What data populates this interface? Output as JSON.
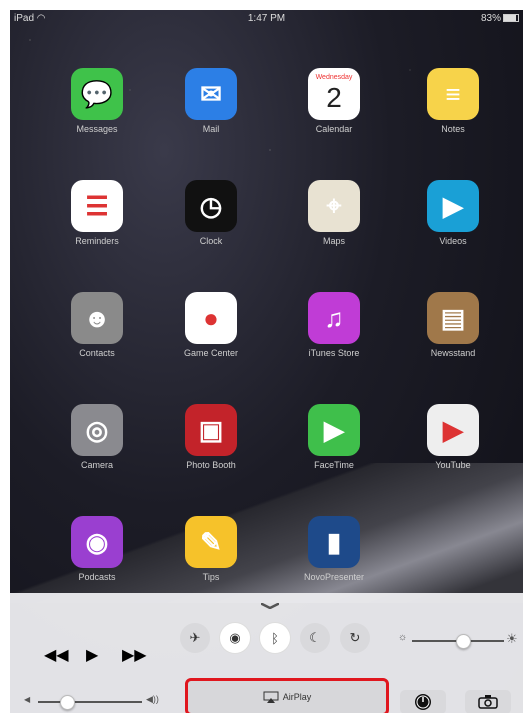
{
  "status": {
    "left": "iPad",
    "time": "1:47 PM",
    "battery": "83%"
  },
  "apps": [
    {
      "label": "Messages",
      "icon": "messages-icon",
      "color": "#3fc24a"
    },
    {
      "label": "Mail",
      "icon": "mail-icon",
      "color": "#2c7fe6"
    },
    {
      "label": "Calendar",
      "icon": "calendar-icon",
      "color": "#ffffff",
      "day_name": "Wednesday",
      "day_num": "2"
    },
    {
      "label": "Notes",
      "icon": "notes-icon",
      "color": "#f7d34a"
    },
    {
      "label": "Reminders",
      "icon": "reminders-icon",
      "color": "#ffffff"
    },
    {
      "label": "Clock",
      "icon": "clock-icon",
      "color": "#111111"
    },
    {
      "label": "Maps",
      "icon": "maps-icon",
      "color": "#e8e2d2"
    },
    {
      "label": "Videos",
      "icon": "videos-icon",
      "color": "#1aa0d6"
    },
    {
      "label": "Contacts",
      "icon": "contacts-icon",
      "color": "#8a8a8a"
    },
    {
      "label": "Game Center",
      "icon": "game-center-icon",
      "color": "#ffffff"
    },
    {
      "label": "iTunes Store",
      "icon": "itunes-store-icon",
      "color": "#c03cd6"
    },
    {
      "label": "Newsstand",
      "icon": "newsstand-icon",
      "color": "#a0784a"
    },
    {
      "label": "Camera",
      "icon": "camera-icon",
      "color": "#8a8a8f"
    },
    {
      "label": "Photo Booth",
      "icon": "photo-booth-icon",
      "color": "#c3232a"
    },
    {
      "label": "FaceTime",
      "icon": "facetime-icon",
      "color": "#3fbf4b"
    },
    {
      "label": "YouTube",
      "icon": "youtube-icon",
      "color": "#eeeeee"
    },
    {
      "label": "Podcasts",
      "icon": "podcasts-icon",
      "color": "#9a3fd0"
    },
    {
      "label": "Tips",
      "icon": "tips-icon",
      "color": "#f6c22a"
    },
    {
      "label": "NovoPresenter",
      "icon": "novopresenter-icon",
      "color": "#1e4a8a"
    }
  ],
  "control_center": {
    "airplay_label": "AirPlay",
    "toggles": [
      "airplane-mode-icon",
      "wifi-icon",
      "bluetooth-icon",
      "do-not-disturb-icon",
      "rotation-lock-icon"
    ],
    "volume_level": 0.28,
    "brightness_level": 0.55,
    "highlight_color": "#e0161e"
  }
}
